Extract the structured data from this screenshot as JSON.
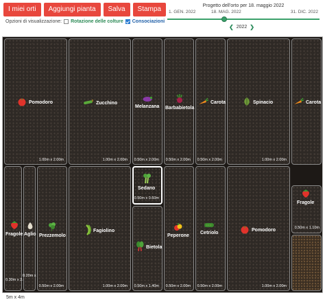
{
  "toolbar": {
    "my_gardens": "I miei orti",
    "add_plant": "Aggiungi pianta",
    "save": "Salva",
    "print": "Stampa"
  },
  "options": {
    "label": "Opzioni di visualizzazione:",
    "rotation": "Rotazione delle colture",
    "rotation_checked": false,
    "companion": "Consociazioni",
    "companion_checked": true
  },
  "timeline": {
    "title": "Progetto dell'orto per 18. maggio 2022",
    "start": "1. GEN. 2022",
    "current": "18. MAG. 2022",
    "end": "31. DIC. 2022",
    "position": 0.376,
    "year": "2022"
  },
  "beds": [
    {
      "plant": "Pomodoro",
      "size": "1.00m x 2.00m",
      "icon": "tomato-icon"
    },
    {
      "plant": "Zucchino",
      "size": "1.00m x 2.00m",
      "icon": "zucchini-icon"
    },
    {
      "plant": "Melanzana",
      "size": "0.50m x 2.00m",
      "icon": "eggplant-icon"
    },
    {
      "plant": "Barbabietola",
      "size": "0.50m x 2.00m",
      "icon": "beetroot-icon"
    },
    {
      "plant": "Carota",
      "size": "0.50m x 2.00m",
      "icon": "carrot-icon"
    },
    {
      "plant": "Spinacio",
      "size": "1.00m x 2.00m",
      "icon": "spinach-icon"
    },
    {
      "plant": "Carota",
      "size": "",
      "icon": "carrot-icon"
    },
    {
      "plant": "Fragole",
      "size": "0.30m x 2.00m",
      "icon": "strawberry-icon"
    },
    {
      "plant": "Aglio",
      "size": "0.20m x 2.00m",
      "icon": "garlic-icon"
    },
    {
      "plant": "Prezzemolo",
      "size": "0.50m x 2.00m",
      "icon": "parsley-icon"
    },
    {
      "plant": "Fagiolino",
      "size": "1.00m x 2.00m",
      "icon": "green-bean-icon"
    },
    {
      "plant": "Sedano",
      "size": "0.50m x 0.60m",
      "icon": "celery-icon"
    },
    {
      "plant": "Bietola",
      "size": "0.50m x 1.40m",
      "icon": "chard-icon"
    },
    {
      "plant": "Peperone",
      "size": "0.50m x 2.00m",
      "icon": "pepper-icon"
    },
    {
      "plant": "Cetriolo",
      "size": "0.50m x 2.00m",
      "icon": "cucumber-icon"
    },
    {
      "plant": "Pomodoro",
      "size": "1.00m x 2.00m",
      "icon": "tomato-icon"
    },
    {
      "plant": "Fragole",
      "size": "0.50m x 1.10m",
      "icon": "strawberry-icon"
    }
  ],
  "scale": "5m x 4m",
  "colors": {
    "button": "#e8473d",
    "accent": "#3aa06a",
    "soil": "#2e2925"
  }
}
